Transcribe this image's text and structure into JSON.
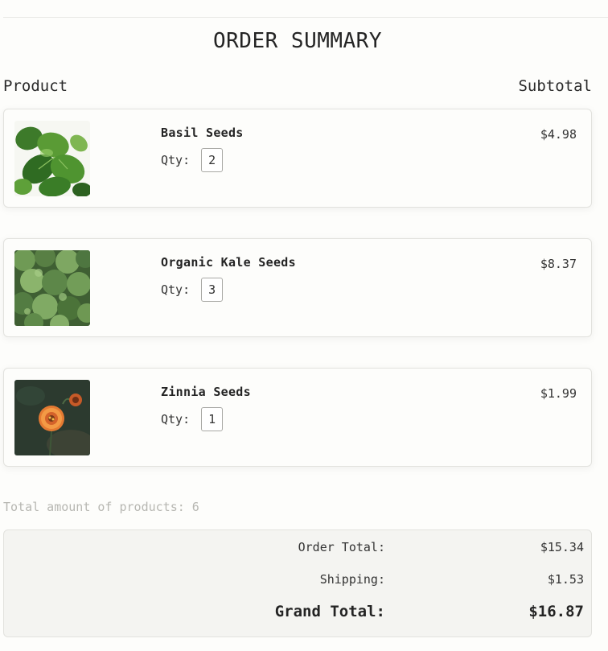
{
  "page": {
    "title": "ORDER SUMMARY",
    "col_product": "Product",
    "col_subtotal": "Subtotal"
  },
  "items": [
    {
      "name": "Basil Seeds",
      "qty_label": "Qty:",
      "qty": "2",
      "price": "$4.98",
      "image": "basil-leaves-photo"
    },
    {
      "name": "Organic Kale Seeds",
      "qty_label": "Qty:",
      "qty": "3",
      "price": "$8.37",
      "image": "kale-leaves-photo"
    },
    {
      "name": "Zinnia Seeds",
      "qty_label": "Qty:",
      "qty": "1",
      "price": "$1.99",
      "image": "zinnia-flower-photo"
    }
  ],
  "summary": {
    "total_products": "Total amount of products: 6",
    "order_total_label": "Order Total:",
    "order_total": "$15.34",
    "shipping_label": "Shipping:",
    "shipping": "$1.53",
    "grand_total_label": "Grand Total:",
    "grand_total": "$16.87"
  }
}
